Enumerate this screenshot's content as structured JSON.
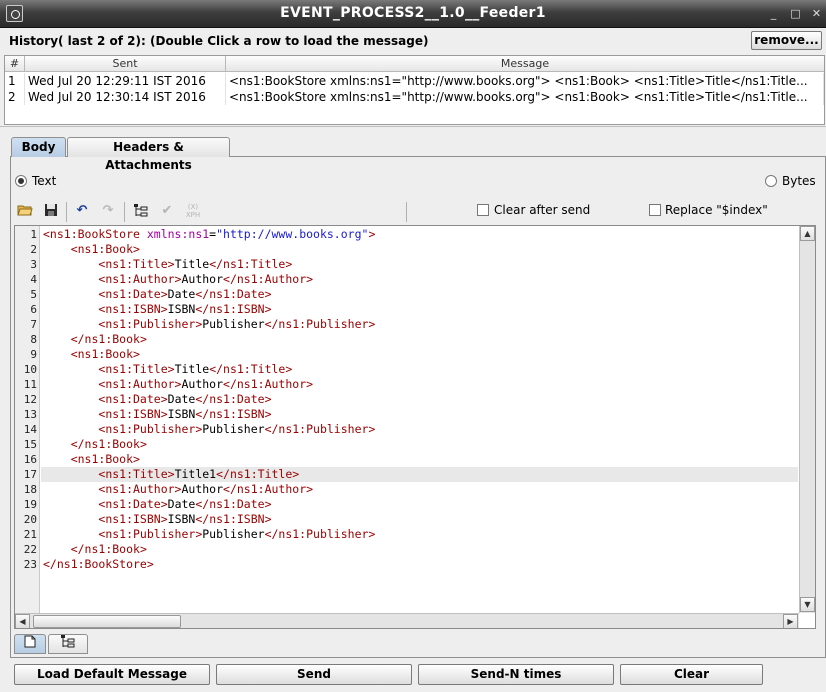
{
  "window": {
    "title": "EVENT_PROCESS2__1.0__Feeder1",
    "minimize_glyph": "_",
    "maximize_glyph": "□",
    "close_glyph": "✕"
  },
  "history": {
    "label": "History( last 2 of 2):",
    "hint": "(Double Click a row to load the message)",
    "remove_label": "remove...",
    "columns": [
      "#",
      "Sent",
      "Message"
    ],
    "rows": [
      {
        "num": "1",
        "sent": "Wed Jul 20 12:29:11 IST 2016",
        "message": "<ns1:BookStore xmlns:ns1=\"http://www.books.org\">     <ns1:Book>        <ns1:Title>Title</ns1:Title..."
      },
      {
        "num": "2",
        "sent": "Wed Jul 20 12:30:14 IST 2016",
        "message": "<ns1:BookStore xmlns:ns1=\"http://www.books.org\">     <ns1:Book>        <ns1:Title>Title</ns1:Title..."
      }
    ]
  },
  "tabs": {
    "body": "Body",
    "headers": "Headers & Attachments"
  },
  "format": {
    "text_label": "Text",
    "bytes_label": "Bytes",
    "selected": "Text"
  },
  "toolbar": {
    "clear_after_send": "Clear after send",
    "replace_index": "Replace \"$index\""
  },
  "editor": {
    "current_line": 17,
    "lines": [
      {
        "n": "1",
        "indent": "",
        "parts": [
          [
            "tg",
            "<ns1:BookStore "
          ],
          [
            "at",
            "xmlns:ns1"
          ],
          [
            "tx",
            "="
          ],
          [
            "vl",
            "\"http://www.books.org\""
          ],
          [
            "tg",
            ">"
          ]
        ]
      },
      {
        "n": "2",
        "indent": "    ",
        "parts": [
          [
            "tg",
            "<ns1:Book>"
          ]
        ]
      },
      {
        "n": "3",
        "indent": "        ",
        "parts": [
          [
            "tg",
            "<ns1:Title>"
          ],
          [
            "tx",
            "Title"
          ],
          [
            "tg",
            "</ns1:Title>"
          ]
        ]
      },
      {
        "n": "4",
        "indent": "        ",
        "parts": [
          [
            "tg",
            "<ns1:Author>"
          ],
          [
            "tx",
            "Author"
          ],
          [
            "tg",
            "</ns1:Author>"
          ]
        ]
      },
      {
        "n": "5",
        "indent": "        ",
        "parts": [
          [
            "tg",
            "<ns1:Date>"
          ],
          [
            "tx",
            "Date"
          ],
          [
            "tg",
            "</ns1:Date>"
          ]
        ]
      },
      {
        "n": "6",
        "indent": "        ",
        "parts": [
          [
            "tg",
            "<ns1:ISBN>"
          ],
          [
            "tx",
            "ISBN"
          ],
          [
            "tg",
            "</ns1:ISBN>"
          ]
        ]
      },
      {
        "n": "7",
        "indent": "        ",
        "parts": [
          [
            "tg",
            "<ns1:Publisher>"
          ],
          [
            "tx",
            "Publisher"
          ],
          [
            "tg",
            "</ns1:Publisher>"
          ]
        ]
      },
      {
        "n": "8",
        "indent": "    ",
        "parts": [
          [
            "tg",
            "</ns1:Book>"
          ]
        ]
      },
      {
        "n": "9",
        "indent": "    ",
        "parts": [
          [
            "tg",
            "<ns1:Book>"
          ]
        ]
      },
      {
        "n": "10",
        "indent": "        ",
        "parts": [
          [
            "tg",
            "<ns1:Title>"
          ],
          [
            "tx",
            "Title"
          ],
          [
            "tg",
            "</ns1:Title>"
          ]
        ]
      },
      {
        "n": "11",
        "indent": "        ",
        "parts": [
          [
            "tg",
            "<ns1:Author>"
          ],
          [
            "tx",
            "Author"
          ],
          [
            "tg",
            "</ns1:Author>"
          ]
        ]
      },
      {
        "n": "12",
        "indent": "        ",
        "parts": [
          [
            "tg",
            "<ns1:Date>"
          ],
          [
            "tx",
            "Date"
          ],
          [
            "tg",
            "</ns1:Date>"
          ]
        ]
      },
      {
        "n": "13",
        "indent": "        ",
        "parts": [
          [
            "tg",
            "<ns1:ISBN>"
          ],
          [
            "tx",
            "ISBN"
          ],
          [
            "tg",
            "</ns1:ISBN>"
          ]
        ]
      },
      {
        "n": "14",
        "indent": "        ",
        "parts": [
          [
            "tg",
            "<ns1:Publisher>"
          ],
          [
            "tx",
            "Publisher"
          ],
          [
            "tg",
            "</ns1:Publisher>"
          ]
        ]
      },
      {
        "n": "15",
        "indent": "    ",
        "parts": [
          [
            "tg",
            "</ns1:Book>"
          ]
        ]
      },
      {
        "n": "16",
        "indent": "    ",
        "parts": [
          [
            "tg",
            "<ns1:Book>"
          ]
        ]
      },
      {
        "n": "17",
        "indent": "        ",
        "parts": [
          [
            "tg",
            "<ns1:Title>"
          ],
          [
            "tx",
            "Title1"
          ],
          [
            "tg",
            "</ns1:Title>"
          ]
        ]
      },
      {
        "n": "18",
        "indent": "        ",
        "parts": [
          [
            "tg",
            "<ns1:Author>"
          ],
          [
            "tx",
            "Author"
          ],
          [
            "tg",
            "</ns1:Author>"
          ]
        ]
      },
      {
        "n": "19",
        "indent": "        ",
        "parts": [
          [
            "tg",
            "<ns1:Date>"
          ],
          [
            "tx",
            "Date"
          ],
          [
            "tg",
            "</ns1:Date>"
          ]
        ]
      },
      {
        "n": "20",
        "indent": "        ",
        "parts": [
          [
            "tg",
            "<ns1:ISBN>"
          ],
          [
            "tx",
            "ISBN"
          ],
          [
            "tg",
            "</ns1:ISBN>"
          ]
        ]
      },
      {
        "n": "21",
        "indent": "        ",
        "parts": [
          [
            "tg",
            "<ns1:Publisher>"
          ],
          [
            "tx",
            "Publisher"
          ],
          [
            "tg",
            "</ns1:Publisher>"
          ]
        ]
      },
      {
        "n": "22",
        "indent": "    ",
        "parts": [
          [
            "tg",
            "</ns1:Book>"
          ]
        ]
      },
      {
        "n": "23",
        "indent": "",
        "parts": [
          [
            "tg",
            "</ns1:BookStore>"
          ]
        ]
      }
    ]
  },
  "buttons": {
    "load_default": "Load Default Message",
    "send": "Send",
    "send_n": "Send-N times",
    "clear": "Clear"
  },
  "colors": {
    "tag": "#990000",
    "attribute": "#a000a0",
    "value": "#1a1ad0",
    "active_tab": "#b7cde4"
  }
}
